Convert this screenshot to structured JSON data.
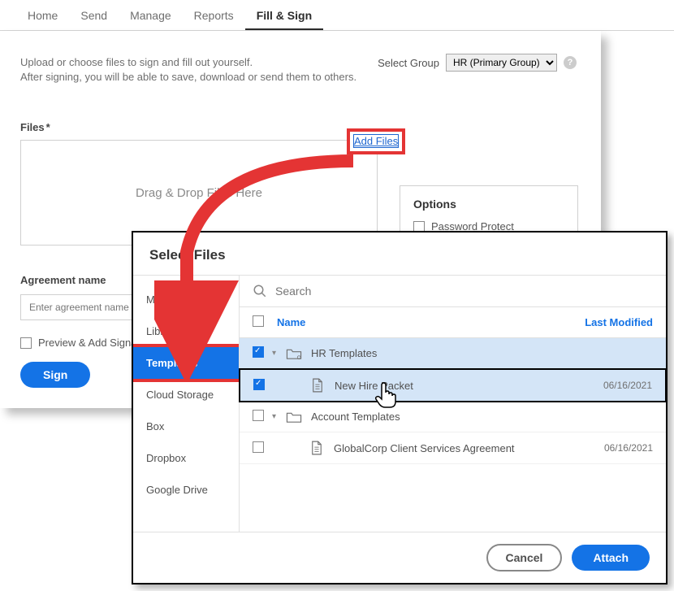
{
  "nav": {
    "items": [
      "Home",
      "Send",
      "Manage",
      "Reports",
      "Fill & Sign"
    ],
    "active": 4
  },
  "instruction_line1": "Upload or choose files to sign and fill out yourself.",
  "instruction_line2": "After signing, you will be able to save, download or send them to others.",
  "select_group": {
    "label": "Select Group",
    "value": "HR (Primary Group)"
  },
  "files": {
    "label": "Files",
    "dropzone": "Drag & Drop Files Here",
    "add_link": "Add Files"
  },
  "options": {
    "title": "Options",
    "password": "Password Protect"
  },
  "agreement": {
    "label": "Agreement name",
    "placeholder": "Enter agreement name"
  },
  "preview_label": "Preview & Add Signa",
  "sign_btn": "Sign",
  "modal": {
    "title": "Select Files",
    "sidebar": [
      "My Computer",
      "Library",
      "Templates",
      "Cloud Storage",
      "Box",
      "Dropbox",
      "Google Drive"
    ],
    "search_placeholder": "Search",
    "col_name": "Name",
    "col_date": "Last Modified",
    "rows": [
      {
        "name": "HR Templates",
        "date": "",
        "checked": true,
        "type": "folder"
      },
      {
        "name": "New Hire Packet",
        "date": "06/16/2021",
        "checked": true,
        "type": "file",
        "indent": true,
        "selected": true
      },
      {
        "name": "Account Templates",
        "date": "",
        "checked": false,
        "type": "folder"
      },
      {
        "name": "GlobalCorp Client Services Agreement",
        "date": "06/16/2021",
        "checked": false,
        "type": "file",
        "indent": true
      }
    ],
    "cancel": "Cancel",
    "attach": "Attach"
  }
}
